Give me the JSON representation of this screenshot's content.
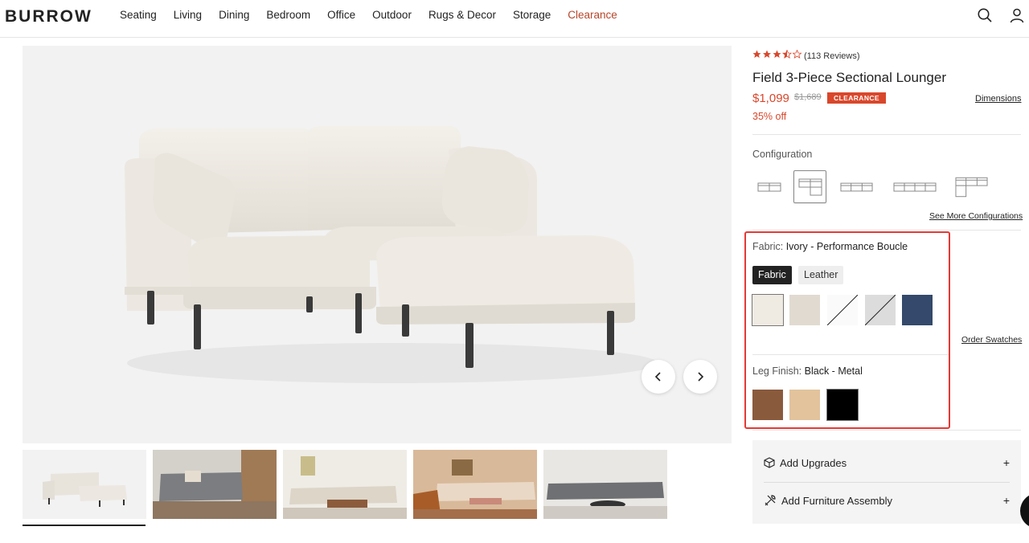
{
  "brand": "BURROW",
  "nav": {
    "items": [
      "Seating",
      "Living",
      "Dining",
      "Bedroom",
      "Office",
      "Outdoor",
      "Rugs & Decor",
      "Storage",
      "Clearance"
    ],
    "clearance_color": "#b5462a"
  },
  "header_icons": [
    "search-icon",
    "user-icon"
  ],
  "product": {
    "rating_text": "(113 Reviews)",
    "rating": 3.5,
    "rating_max": 5,
    "title": "Field 3-Piece Sectional Lounger",
    "price": "$1,099",
    "original_price": "$1,689",
    "badge": "CLEARANCE",
    "discount": "35% off",
    "dimensions_link": "Dimensions",
    "accent_color": "#d9472b"
  },
  "configuration": {
    "label": "Configuration",
    "selected_index": 1,
    "see_more": "See More Configurations"
  },
  "fabric": {
    "label": "Fabric:",
    "value": "Ivory - Performance Boucle",
    "tabs": [
      "Fabric",
      "Leather"
    ],
    "active_tab": "Fabric",
    "swatches": [
      "#efebe3",
      "#e1dad0",
      "#ffffff",
      "#d9d9d9",
      "#34496b"
    ],
    "selected_swatch": 0,
    "order_swatches": "Order Swatches"
  },
  "leg_finish": {
    "label": "Leg Finish:",
    "value": "Black - Metal",
    "swatches": [
      "#8a5a3c",
      "#e2c39c",
      "#000000"
    ],
    "selected_swatch": 2
  },
  "addons": [
    {
      "label": "Add Upgrades",
      "icon": "box-icon"
    },
    {
      "label": "Add Furniture Assembly",
      "icon": "tools-icon"
    }
  ],
  "highlight_color": "#e53935"
}
